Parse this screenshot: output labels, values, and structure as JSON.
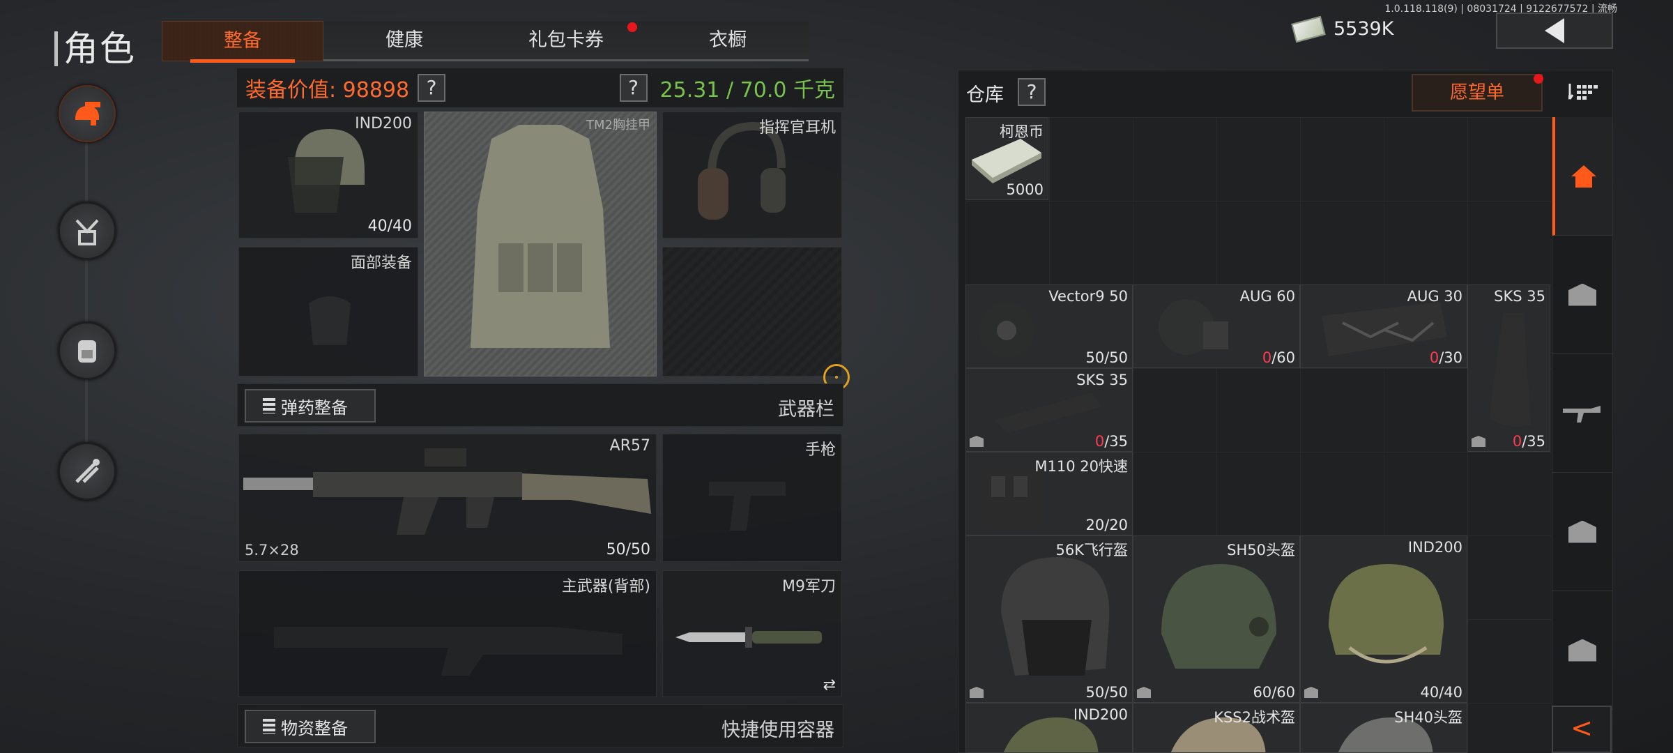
{
  "version": "1.0.118.118(9) | 08031724 | 9122677572 | 流畅",
  "page_title": "角色",
  "tabs": [
    {
      "label": "整备",
      "active": true
    },
    {
      "label": "健康"
    },
    {
      "label": "礼包卡券",
      "badge": true
    },
    {
      "label": "衣橱"
    }
  ],
  "currency": {
    "value": "5539K"
  },
  "equipment": {
    "value_label": "装备价值: 98898",
    "help": "?",
    "weight": "25.31 / 70.0 千克",
    "helmet": {
      "name": "IND200",
      "count": "40/40"
    },
    "vest": {
      "name": "TM2胸挂甲"
    },
    "headset": {
      "name": "指挥官耳机"
    },
    "face": {
      "name": "面部装备"
    },
    "ammo_section": {
      "button": "弹药整备",
      "title": "武器栏"
    },
    "primary": {
      "name": "AR57",
      "caliber": "5.7×28",
      "count": "50/50"
    },
    "pistol": {
      "name": "手枪"
    },
    "back_weapon": {
      "name": "主武器(背部)"
    },
    "knife": {
      "name": "M9军刀",
      "swap": "⇄"
    },
    "supply_section": {
      "button": "物资整备",
      "title": "快捷使用容器"
    }
  },
  "warehouse": {
    "title": "仓库",
    "help": "?",
    "wishlist": "愿望单",
    "collapse": "<",
    "items": [
      {
        "name": "柯恩币",
        "count": "5000"
      },
      {
        "name": "Vector9 50",
        "count": "50/50"
      },
      {
        "name": "AUG 60",
        "count_red": "0",
        "count_rest": "/60"
      },
      {
        "name": "AUG 30",
        "count_red": "0",
        "count_rest": "/30"
      },
      {
        "name": "SKS 35",
        "count_red": "0",
        "count_rest": "/35"
      },
      {
        "name": "SKS 35",
        "count_red": "0",
        "count_rest": "/35"
      },
      {
        "name": "M110 20快速",
        "count": "20/20"
      },
      {
        "name": "56K飞行盔",
        "count": "50/50"
      },
      {
        "name": "SH50头盔",
        "count": "60/60"
      },
      {
        "name": "IND200",
        "count": "40/40"
      },
      {
        "name": "IND200"
      },
      {
        "name": "KSS2战术盔"
      },
      {
        "name": "SH40头盔"
      }
    ]
  },
  "icons": {
    "nav": [
      "gear-loadout-icon",
      "parachute-bag-icon",
      "backpack-icon",
      "tools-icon"
    ],
    "side_tabs": [
      "home-icon",
      "storage-box-icon",
      "rifle-icon",
      "storage-box-icon",
      "storage-box-icon"
    ]
  },
  "colors": {
    "accent": "#ff6a2e",
    "weight": "#78c24d",
    "badge": "#e8171c"
  }
}
